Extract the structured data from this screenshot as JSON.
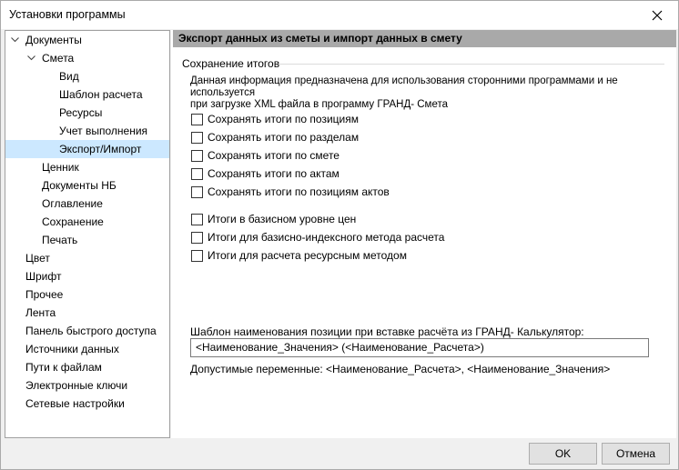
{
  "window": {
    "title": "Установки программы"
  },
  "tree": {
    "items": [
      {
        "label": "Документы",
        "level": 0,
        "expanded": true
      },
      {
        "label": "Смета",
        "level": 1,
        "expanded": true
      },
      {
        "label": "Вид",
        "level": 2
      },
      {
        "label": "Шаблон расчета",
        "level": 2
      },
      {
        "label": "Ресурсы",
        "level": 2
      },
      {
        "label": "Учет выполнения",
        "level": 2
      },
      {
        "label": "Экспорт/Импорт",
        "level": 2,
        "selected": true
      },
      {
        "label": "Ценник",
        "level": 1
      },
      {
        "label": "Документы НБ",
        "level": 1
      },
      {
        "label": "Оглавление",
        "level": 1
      },
      {
        "label": "Сохранение",
        "level": 1
      },
      {
        "label": "Печать",
        "level": 1
      },
      {
        "label": "Цвет",
        "level": 0
      },
      {
        "label": "Шрифт",
        "level": 0
      },
      {
        "label": "Прочее",
        "level": 0
      },
      {
        "label": "Лента",
        "level": 0
      },
      {
        "label": "Панель быстрого доступа",
        "level": 0
      },
      {
        "label": "Источники данных",
        "level": 0
      },
      {
        "label": "Пути к файлам",
        "level": 0
      },
      {
        "label": "Электронные ключи",
        "level": 0
      },
      {
        "label": "Сетевые настройки",
        "level": 0
      }
    ]
  },
  "panel": {
    "header": "Экспорт данных  из сметы и импорт данных  в смету",
    "group_title": "Сохранение итогов",
    "info_line1": "Данная информация предназначена для использования сторонними программами и не используется",
    "info_line2": "при загрузке XML файла в программу ГРАНД- Смета",
    "checkboxes_a": [
      {
        "label": "Сохранять итоги по позициям",
        "checked": false
      },
      {
        "label": "Сохранять итоги по разделам",
        "checked": false
      },
      {
        "label": "Сохранять итоги по смете",
        "checked": false
      },
      {
        "label": "Сохранять итоги по актам",
        "checked": false
      },
      {
        "label": "Сохранять итоги по позициям актов",
        "checked": false
      }
    ],
    "checkboxes_b": [
      {
        "label": "Итоги в базисном уровне цен",
        "checked": false
      },
      {
        "label": "Итоги для базисно-индексного метода расчета",
        "checked": false
      },
      {
        "label": "Итоги для расчета ресурсным методом",
        "checked": false
      }
    ],
    "template_label": "Шаблон наименования позиции при вставке расчёта из ГРАНД- Калькулятор:",
    "template_value": "<Наименование_Значения> (<Наименование_Расчета>)",
    "variables_text": "Допустимые переменные: <Наименование_Расчета>, <Наименование_Значения>"
  },
  "footer": {
    "ok_label": "OK",
    "cancel_label": "Отмена"
  }
}
